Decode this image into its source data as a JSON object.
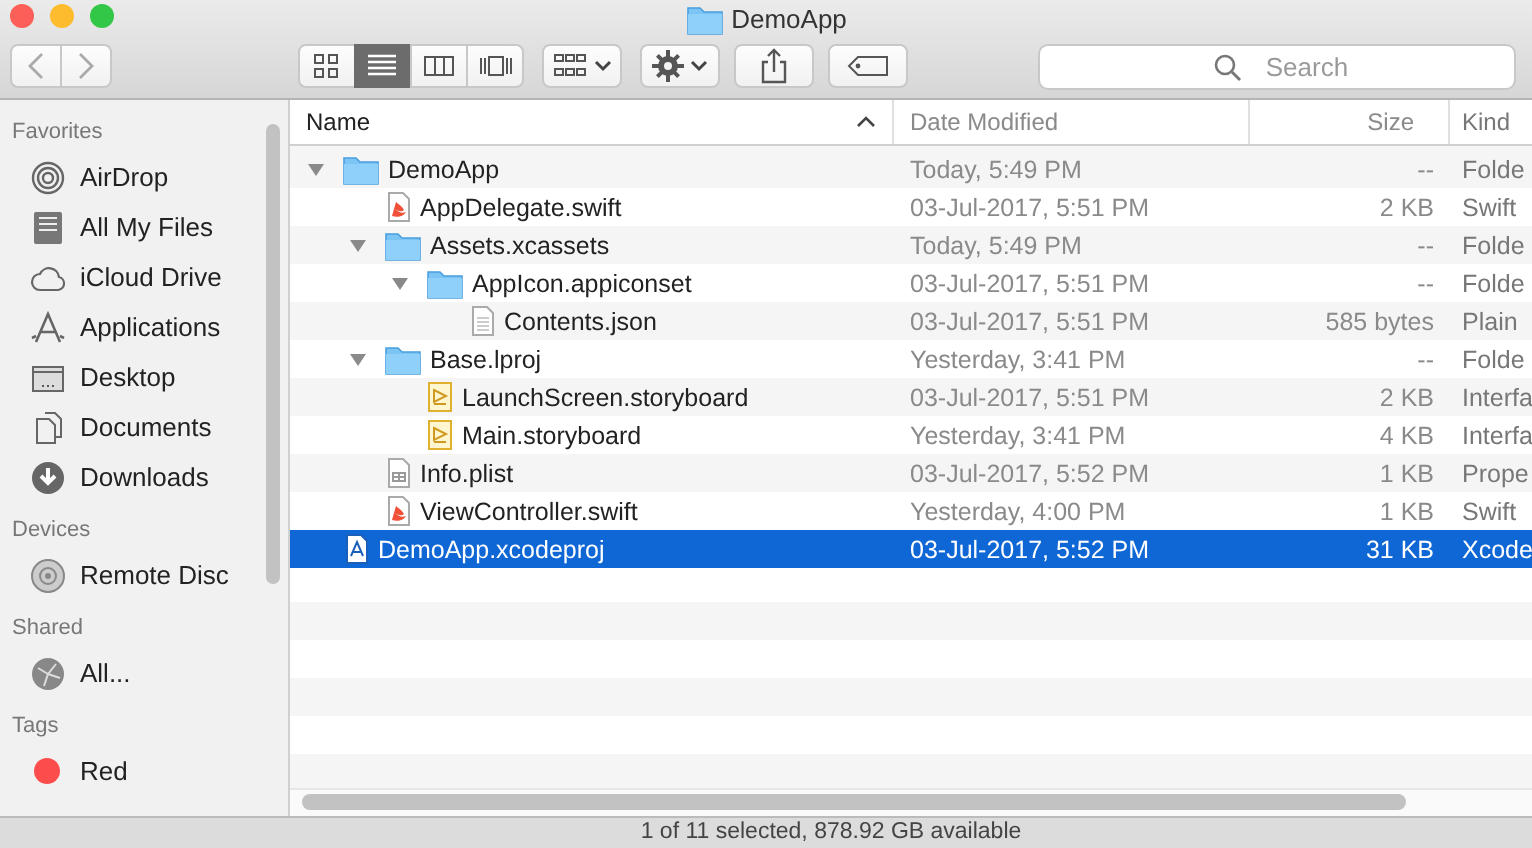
{
  "window": {
    "title": "DemoApp"
  },
  "toolbar": {
    "view_modes": [
      {
        "kind": "icons",
        "selected": false
      },
      {
        "kind": "list",
        "selected": true
      },
      {
        "kind": "columns",
        "selected": false
      },
      {
        "kind": "coverflow",
        "selected": false
      }
    ],
    "search": {
      "placeholder": "Search"
    }
  },
  "sidebar": {
    "sections": [
      {
        "title": "Favorites",
        "items": [
          {
            "kind": "airdrop",
            "label": "AirDrop"
          },
          {
            "kind": "allfiles",
            "label": "All My Files"
          },
          {
            "kind": "cloud",
            "label": "iCloud Drive"
          },
          {
            "kind": "apps",
            "label": "Applications"
          },
          {
            "kind": "desktop",
            "label": "Desktop"
          },
          {
            "kind": "documents",
            "label": "Documents"
          },
          {
            "kind": "downloads",
            "label": "Downloads"
          }
        ]
      },
      {
        "title": "Devices",
        "items": [
          {
            "kind": "disc",
            "label": "Remote Disc"
          }
        ]
      },
      {
        "title": "Shared",
        "items": [
          {
            "kind": "network",
            "label": "All..."
          }
        ]
      },
      {
        "title": "Tags",
        "items": [
          {
            "kind": "tag",
            "label": "Red",
            "color": "#fc4c4c"
          }
        ]
      }
    ]
  },
  "table": {
    "columns": [
      "Name",
      "Date Modified",
      "Size",
      "Kind"
    ],
    "rows": [
      {
        "kind": "folder",
        "name": "DemoApp",
        "date": "Today, 5:49 PM",
        "size": "--",
        "file_kind": "Folde",
        "expanded": true,
        "selected": false,
        "children": [
          {
            "kind": "swift",
            "name": "AppDelegate.swift",
            "date": "03-Jul-2017, 5:51 PM",
            "size": "2 KB",
            "file_kind": "Swift",
            "selected": false
          },
          {
            "kind": "folder",
            "name": "Assets.xcassets",
            "date": "Today, 5:49 PM",
            "size": "--",
            "file_kind": "Folde",
            "expanded": true,
            "selected": false,
            "children": [
              {
                "kind": "folder",
                "name": "AppIcon.appiconset",
                "date": "03-Jul-2017, 5:51 PM",
                "size": "--",
                "file_kind": "Folde",
                "expanded": true,
                "selected": false,
                "children": [
                  {
                    "kind": "text",
                    "name": "Contents.json",
                    "date": "03-Jul-2017, 5:51 PM",
                    "size": "585 bytes",
                    "file_kind": "Plain",
                    "selected": false
                  }
                ]
              }
            ]
          },
          {
            "kind": "folder",
            "name": "Base.lproj",
            "date": "Yesterday, 3:41 PM",
            "size": "--",
            "file_kind": "Folde",
            "expanded": true,
            "selected": false,
            "children": [
              {
                "kind": "storyboard",
                "name": "LaunchScreen.storyboard",
                "date": "03-Jul-2017, 5:51 PM",
                "size": "2 KB",
                "file_kind": "Interfa",
                "selected": false
              },
              {
                "kind": "storyboard",
                "name": "Main.storyboard",
                "date": "Yesterday, 3:41 PM",
                "size": "4 KB",
                "file_kind": "Interfa",
                "selected": false
              }
            ]
          },
          {
            "kind": "plist",
            "name": "Info.plist",
            "date": "03-Jul-2017, 5:52 PM",
            "size": "1 KB",
            "file_kind": "Prope",
            "selected": false
          },
          {
            "kind": "swift",
            "name": "ViewController.swift",
            "date": "Yesterday, 4:00 PM",
            "size": "1 KB",
            "file_kind": "Swift",
            "selected": false
          }
        ]
      },
      {
        "kind": "xcodeproj",
        "name": "DemoApp.xcodeproj",
        "date": "03-Jul-2017, 5:52 PM",
        "size": "31 KB",
        "file_kind": "Xcode",
        "selected": true
      }
    ]
  },
  "status_bar": "1 of 11 selected, 878.92 GB available"
}
